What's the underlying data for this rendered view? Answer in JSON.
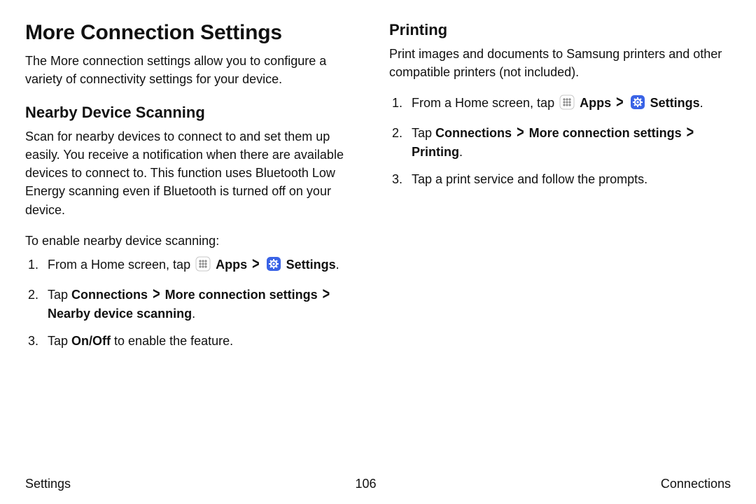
{
  "leftColumn": {
    "h1": "More Connection Settings",
    "intro": "The More connection settings allow you to configure a variety of connectivity settings for your device.",
    "h2": "Nearby Device Scanning",
    "desc": "Scan for nearby devices to connect to and set them up easily. You receive a notification when there are available devices to connect to. This function uses Bluetooth Low Energy scanning even if Bluetooth is turned off on your device.",
    "lead": "To enable nearby device scanning:",
    "step1_prefix": "From a Home screen, tap ",
    "step1_apps": "Apps",
    "step1_settings": "Settings",
    "step2_pre": "Tap ",
    "step2_b1": "Connections",
    "step2_b2": "More connection settings",
    "step2_b3": "Nearby device scanning",
    "step3_pre": "Tap ",
    "step3_b": "On/Off",
    "step3_post": " to enable the feature."
  },
  "rightColumn": {
    "h2": "Printing",
    "desc": "Print images and documents to Samsung printers and other compatible printers (not included).",
    "step1_prefix": "From a Home screen, tap ",
    "step1_apps": "Apps",
    "step1_settings": "Settings",
    "step2_pre": "Tap ",
    "step2_b1": "Connections",
    "step2_b2": "More connection settings",
    "step2_b3": "Printing",
    "step3": "Tap a print service and follow the prompts."
  },
  "footer": {
    "left": "Settings",
    "center": "106",
    "right": "Connections"
  },
  "glyphs": {
    "chevron": ">",
    "period": "."
  }
}
